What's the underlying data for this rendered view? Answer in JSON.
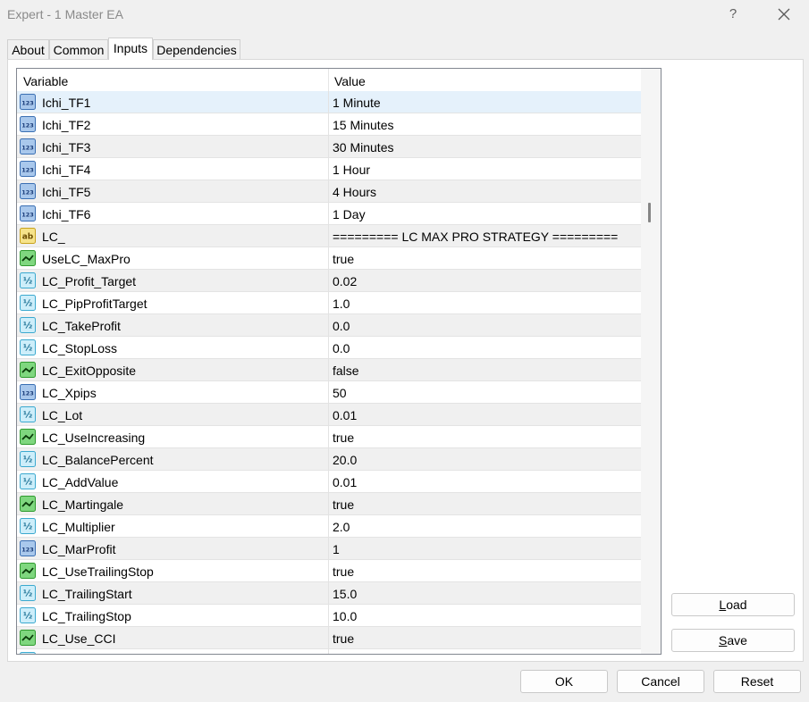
{
  "window": {
    "title": "Expert - 1 Master EA",
    "help_glyph": "?",
    "close_icon": "close-icon"
  },
  "tabs": [
    {
      "label": "About"
    },
    {
      "label": "Common"
    },
    {
      "label": "Inputs",
      "active": true
    },
    {
      "label": "Dependencies"
    }
  ],
  "grid": {
    "columns": {
      "variable": "Variable",
      "value": "Value"
    },
    "rows": [
      {
        "type": "int",
        "name": "Ichi_TF1",
        "value": "1 Minute"
      },
      {
        "type": "int",
        "name": "Ichi_TF2",
        "value": "15 Minutes"
      },
      {
        "type": "int",
        "name": "Ichi_TF3",
        "value": "30 Minutes"
      },
      {
        "type": "int",
        "name": "Ichi_TF4",
        "value": "1 Hour"
      },
      {
        "type": "int",
        "name": "Ichi_TF5",
        "value": "4 Hours"
      },
      {
        "type": "int",
        "name": "Ichi_TF6",
        "value": "1 Day"
      },
      {
        "type": "string",
        "name": "LC_",
        "value": "========= LC MAX PRO STRATEGY ========="
      },
      {
        "type": "bool",
        "name": "UseLC_MaxPro",
        "value": "true"
      },
      {
        "type": "double",
        "name": "LC_Profit_Target",
        "value": "0.02"
      },
      {
        "type": "double",
        "name": "LC_PipProfitTarget",
        "value": "1.0"
      },
      {
        "type": "double",
        "name": "LC_TakeProfit",
        "value": "0.0"
      },
      {
        "type": "double",
        "name": "LC_StopLoss",
        "value": "0.0"
      },
      {
        "type": "bool",
        "name": "LC_ExitOpposite",
        "value": "false"
      },
      {
        "type": "int",
        "name": "LC_Xpips",
        "value": "50"
      },
      {
        "type": "double",
        "name": "LC_Lot",
        "value": "0.01"
      },
      {
        "type": "bool",
        "name": "LC_UseIncreasing",
        "value": "true"
      },
      {
        "type": "double",
        "name": "LC_BalancePercent",
        "value": "20.0"
      },
      {
        "type": "double",
        "name": "LC_AddValue",
        "value": "0.01"
      },
      {
        "type": "bool",
        "name": "LC_Martingale",
        "value": "true"
      },
      {
        "type": "double",
        "name": "LC_Multiplier",
        "value": "2.0"
      },
      {
        "type": "int",
        "name": "LC_MarProfit",
        "value": "1"
      },
      {
        "type": "bool",
        "name": "LC_UseTrailingStop",
        "value": "true"
      },
      {
        "type": "double",
        "name": "LC_TrailingStart",
        "value": "15.0"
      },
      {
        "type": "double",
        "name": "LC_TrailingStop",
        "value": "10.0"
      },
      {
        "type": "bool",
        "name": "LC_Use_CCI",
        "value": "true"
      },
      {
        "type": "double",
        "name": "",
        "value": ""
      }
    ]
  },
  "icons": {
    "int": {
      "label": "123",
      "fill": "#a9c8ec",
      "stroke": "#3a6fb3",
      "text": "#1b3d7a"
    },
    "double": {
      "label": "½",
      "fill": "#cdeefa",
      "stroke": "#3ba9cf",
      "text": "#1a6f93"
    },
    "bool": {
      "fill": "#7fd77f",
      "stroke": "#2f9a2f",
      "text": "#0b3d0b"
    },
    "string": {
      "label": "ab",
      "fill": "#f6e38a",
      "stroke": "#c7a21d",
      "text": "#6a4b00"
    }
  },
  "side_buttons": {
    "load": "Load",
    "load_key": "L",
    "load_rest": "oad",
    "save": "Save",
    "save_key": "S",
    "save_rest": "ave"
  },
  "footer_buttons": {
    "ok": "OK",
    "cancel": "Cancel",
    "reset": "Reset"
  }
}
